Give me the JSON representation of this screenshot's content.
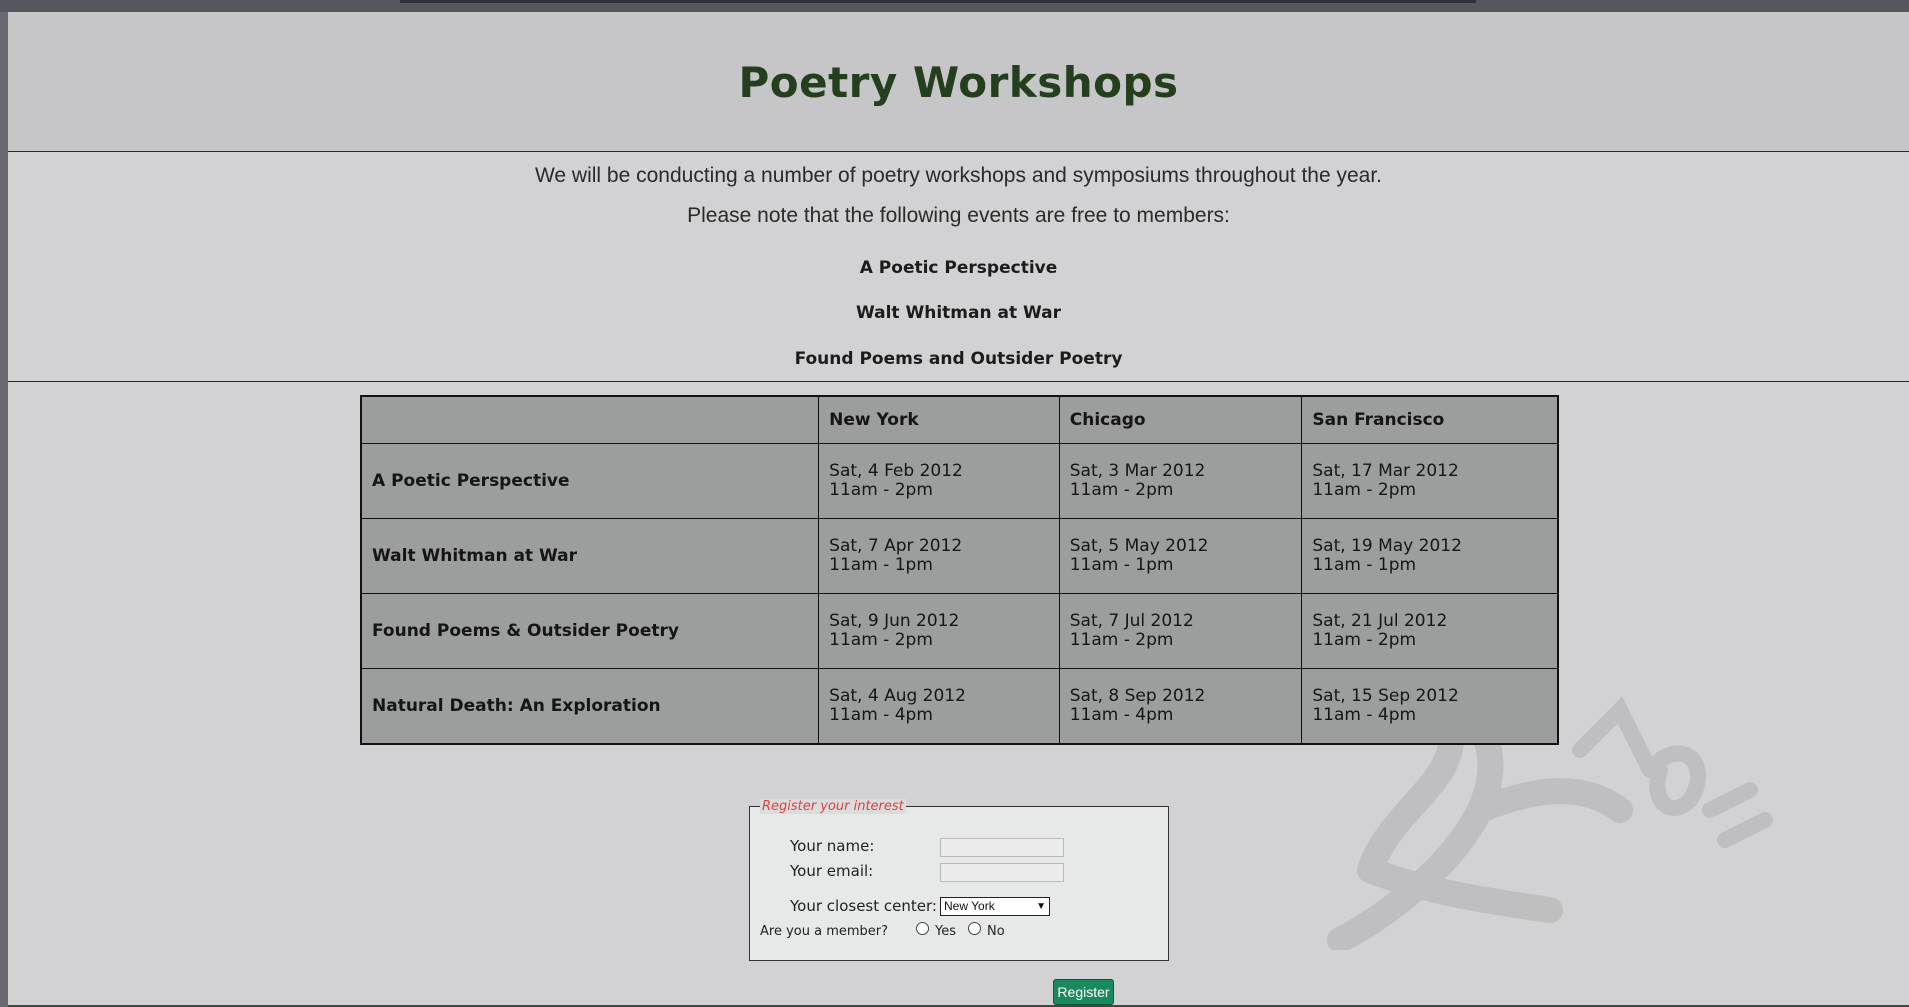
{
  "header": {
    "title": "Poetry Workshops"
  },
  "intro": {
    "line1": "We will be conducting a number of poetry workshops and symposiums throughout the year.",
    "line2": "Please note that the following events are free to members:",
    "free_events": [
      "A Poetic Perspective",
      "Walt Whitman at War",
      "Found Poems and Outsider Poetry"
    ]
  },
  "schedule": {
    "columns": [
      "",
      "New York",
      "Chicago",
      "San Francisco"
    ],
    "rows": [
      {
        "event": "A Poetic Perspective",
        "cells": [
          {
            "date": "Sat, 4 Feb 2012",
            "time": "11am - 2pm"
          },
          {
            "date": "Sat, 3 Mar 2012",
            "time": "11am - 2pm"
          },
          {
            "date": "Sat, 17 Mar 2012",
            "time": "11am - 2pm"
          }
        ]
      },
      {
        "event": "Walt Whitman at War",
        "cells": [
          {
            "date": "Sat, 7 Apr 2012",
            "time": "11am - 1pm"
          },
          {
            "date": "Sat, 5 May 2012",
            "time": "11am - 1pm"
          },
          {
            "date": "Sat, 19 May 2012",
            "time": "11am - 1pm"
          }
        ]
      },
      {
        "event": "Found Poems & Outsider Poetry",
        "cells": [
          {
            "date": "Sat, 9 Jun 2012",
            "time": "11am - 2pm"
          },
          {
            "date": "Sat, 7 Jul 2012",
            "time": "11am - 2pm"
          },
          {
            "date": "Sat, 21 Jul 2012",
            "time": "11am - 2pm"
          }
        ]
      },
      {
        "event": "Natural Death: An Exploration",
        "cells": [
          {
            "date": "Sat, 4 Aug 2012",
            "time": "11am - 4pm"
          },
          {
            "date": "Sat, 8 Sep 2012",
            "time": "11am - 4pm"
          },
          {
            "date": "Sat, 15 Sep 2012",
            "time": "11am - 4pm"
          }
        ]
      }
    ]
  },
  "register": {
    "legend": "Register your interest",
    "name_label": "Your name:",
    "name_value": "",
    "email_label": "Your email:",
    "email_value": "",
    "center_label": "Your closest center:",
    "center_selected": "New York",
    "member_label": "Are you a member?",
    "yes_label": "Yes",
    "no_label": "No",
    "submit_label": "Register"
  },
  "colors": {
    "title": "#243f1e",
    "legend": "#d64545",
    "button": "#1a8a5e",
    "table_bg": "#9c9e9d"
  }
}
